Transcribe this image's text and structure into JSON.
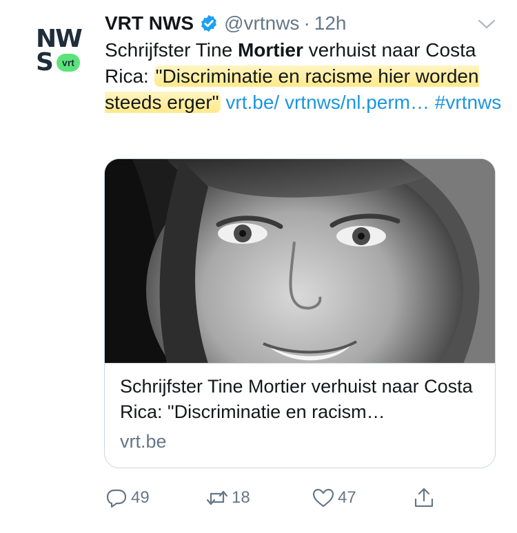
{
  "avatar": {
    "logo_top": "NW",
    "logo_bottom": "S",
    "badge": "vrt"
  },
  "header": {
    "name": "VRT NWS",
    "handle": "@vrtnws",
    "dot": "·",
    "time": "12h"
  },
  "tweet": {
    "part1": "Schrijfster Tine ",
    "bold": "Mortier",
    "part2": " verhuist naar Costa Rica: ",
    "highlighted": "\"Discriminatie en racisme hier worden steeds erger\"",
    "space": " ",
    "link": "vrt.be/ vrtnws/nl.perm…",
    "hashtag": "#vrtnws"
  },
  "card": {
    "title": "Schrijfster Tine Mortier verhuist naar Costa Rica: \"Discriminatie en racism…",
    "domain": "vrt.be"
  },
  "actions": {
    "replies": "49",
    "retweets": "18",
    "likes": "47"
  },
  "colors": {
    "link": "#1b95e0",
    "muted": "#657786",
    "verified": "#1da1f2",
    "highlight": "#ffe27a",
    "logo_green": "#5be37a"
  }
}
